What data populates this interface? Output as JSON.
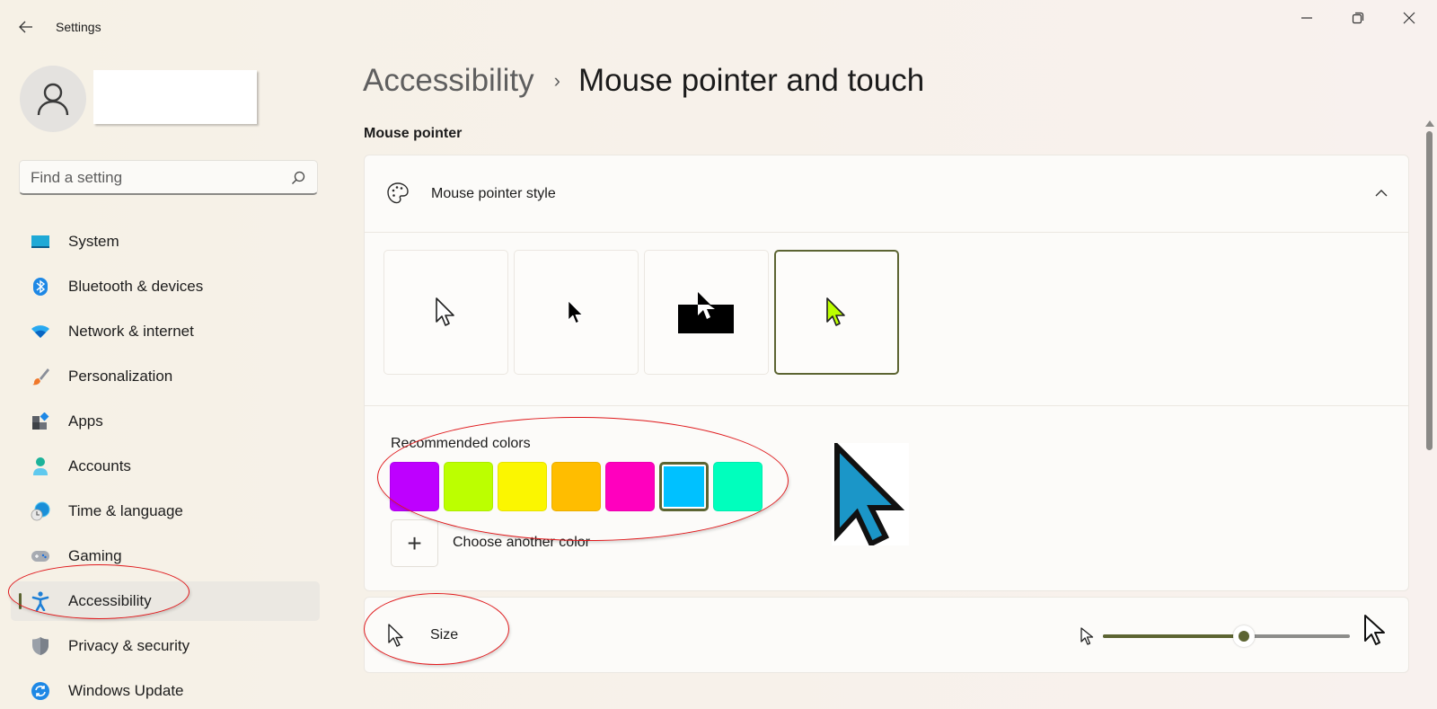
{
  "window": {
    "title": "Settings",
    "controls": {
      "minimize": "minimize-icon",
      "maximize": "restore-icon",
      "close": "close-icon"
    }
  },
  "sidebar": {
    "profile": {
      "name": ""
    },
    "search": {
      "placeholder": "Find a setting",
      "value": ""
    },
    "items": [
      {
        "label": "System",
        "icon": "system-icon"
      },
      {
        "label": "Bluetooth & devices",
        "icon": "bluetooth-icon"
      },
      {
        "label": "Network & internet",
        "icon": "wifi-icon"
      },
      {
        "label": "Personalization",
        "icon": "brush-icon"
      },
      {
        "label": "Apps",
        "icon": "apps-icon"
      },
      {
        "label": "Accounts",
        "icon": "accounts-icon"
      },
      {
        "label": "Time & language",
        "icon": "globe-clock-icon"
      },
      {
        "label": "Gaming",
        "icon": "gamepad-icon"
      },
      {
        "label": "Accessibility",
        "icon": "accessibility-icon",
        "active": true
      },
      {
        "label": "Privacy & security",
        "icon": "shield-icon"
      },
      {
        "label": "Windows Update",
        "icon": "update-icon"
      }
    ]
  },
  "main": {
    "breadcrumb": {
      "parent": "Accessibility",
      "separator": "›",
      "current": "Mouse pointer and touch"
    },
    "section_title": "Mouse pointer",
    "pointer_style": {
      "label": "Mouse pointer style",
      "expanded": true,
      "styles": [
        {
          "name": "white",
          "selected": false
        },
        {
          "name": "black",
          "selected": false
        },
        {
          "name": "inverted",
          "selected": false
        },
        {
          "name": "custom",
          "selected": true
        }
      ],
      "recommended_label": "Recommended colors",
      "colors": [
        {
          "hex": "#be00ff",
          "selected": false
        },
        {
          "hex": "#bcff00",
          "selected": false
        },
        {
          "hex": "#fbf600",
          "selected": false
        },
        {
          "hex": "#ffbd00",
          "selected": false
        },
        {
          "hex": "#ff00be",
          "selected": false
        },
        {
          "hex": "#00c1ff",
          "selected": true
        },
        {
          "hex": "#00ffbd",
          "selected": false
        }
      ],
      "add_color_label": "Choose another color",
      "add_color_glyph": "+",
      "custom_color": "#bcff00",
      "preview_color": "#1b96c8"
    },
    "size": {
      "label": "Size",
      "value_fraction": 0.57
    }
  },
  "theme": {
    "accent": "#5c6432",
    "annotation": "#e0191c"
  }
}
